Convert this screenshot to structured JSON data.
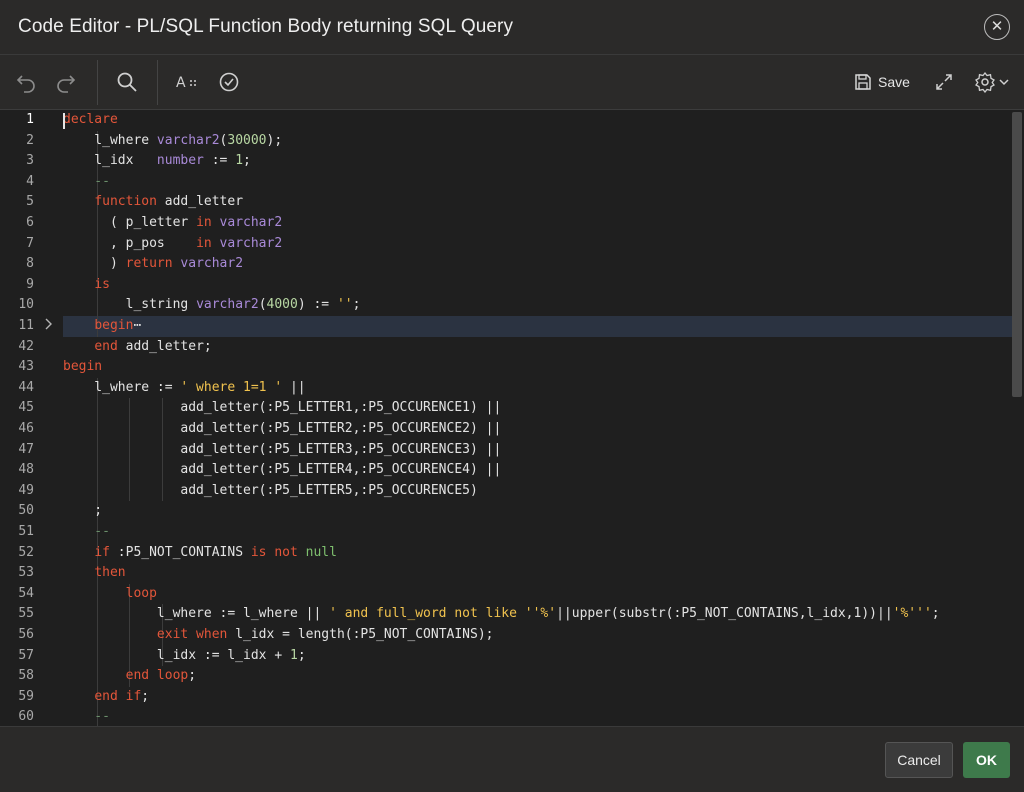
{
  "dialog": {
    "title": "Code Editor - PL/SQL Function Body returning SQL Query",
    "close_glyph": "✕"
  },
  "toolbar": {
    "undo_icon": "undo-icon",
    "redo_icon": "redo-icon",
    "search_icon": "search-icon",
    "autocomplete_icon": "autocomplete-icon",
    "validate_icon": "validate-icon",
    "save_label": "Save",
    "fullscreen_icon": "expand-icon",
    "settings_icon": "gear-icon"
  },
  "editor": {
    "lines": [
      {
        "num": "1",
        "tokens": [
          {
            "t": "declare",
            "c": "k"
          }
        ]
      },
      {
        "num": "2",
        "tokens": [
          {
            "t": "    l_where ",
            "c": "f"
          },
          {
            "t": "varchar2",
            "c": "t"
          },
          {
            "t": "(",
            "c": "f"
          },
          {
            "t": "30000",
            "c": "n"
          },
          {
            "t": ");",
            "c": "f"
          }
        ]
      },
      {
        "num": "3",
        "tokens": [
          {
            "t": "    l_idx   ",
            "c": "f"
          },
          {
            "t": "number",
            "c": "t"
          },
          {
            "t": " := ",
            "c": "f"
          },
          {
            "t": "1",
            "c": "n"
          },
          {
            "t": ";",
            "c": "f"
          }
        ]
      },
      {
        "num": "4",
        "tokens": [
          {
            "t": "    --",
            "c": "c"
          }
        ]
      },
      {
        "num": "5",
        "tokens": [
          {
            "t": "    ",
            "c": "f"
          },
          {
            "t": "function",
            "c": "k"
          },
          {
            "t": " add_letter",
            "c": "f"
          }
        ]
      },
      {
        "num": "6",
        "tokens": [
          {
            "t": "      ( p_letter ",
            "c": "f"
          },
          {
            "t": "in",
            "c": "k"
          },
          {
            "t": " ",
            "c": "f"
          },
          {
            "t": "varchar2",
            "c": "t"
          }
        ]
      },
      {
        "num": "7",
        "tokens": [
          {
            "t": "      , p_pos    ",
            "c": "f"
          },
          {
            "t": "in",
            "c": "k"
          },
          {
            "t": " ",
            "c": "f"
          },
          {
            "t": "varchar2",
            "c": "t"
          }
        ]
      },
      {
        "num": "8",
        "tokens": [
          {
            "t": "      ) ",
            "c": "f"
          },
          {
            "t": "return",
            "c": "k"
          },
          {
            "t": " ",
            "c": "f"
          },
          {
            "t": "varchar2",
            "c": "t"
          }
        ]
      },
      {
        "num": "9",
        "tokens": [
          {
            "t": "    ",
            "c": "f"
          },
          {
            "t": "is",
            "c": "k"
          }
        ]
      },
      {
        "num": "10",
        "tokens": [
          {
            "t": "        l_string ",
            "c": "f"
          },
          {
            "t": "varchar2",
            "c": "t"
          },
          {
            "t": "(",
            "c": "f"
          },
          {
            "t": "4000",
            "c": "n"
          },
          {
            "t": ") := ",
            "c": "f"
          },
          {
            "t": "''",
            "c": "s"
          },
          {
            "t": ";",
            "c": "f"
          }
        ]
      },
      {
        "num": "11",
        "tokens": [
          {
            "t": "    ",
            "c": "f"
          },
          {
            "t": "begin",
            "c": "k"
          },
          {
            "t": "⋯",
            "c": "f"
          }
        ]
      },
      {
        "num": "42",
        "tokens": [
          {
            "t": "    ",
            "c": "f"
          },
          {
            "t": "end",
            "c": "k"
          },
          {
            "t": " add_letter;",
            "c": "f"
          }
        ]
      },
      {
        "num": "43",
        "tokens": [
          {
            "t": "begin",
            "c": "k"
          }
        ]
      },
      {
        "num": "44",
        "tokens": [
          {
            "t": "    l_where := ",
            "c": "f"
          },
          {
            "t": "' where 1=1 '",
            "c": "s"
          },
          {
            "t": " ||",
            "c": "f"
          }
        ]
      },
      {
        "num": "45",
        "tokens": [
          {
            "t": "               add_letter(:P5_LETTER1,:P5_OCCURENCE1) ||",
            "c": "f"
          }
        ]
      },
      {
        "num": "46",
        "tokens": [
          {
            "t": "               add_letter(:P5_LETTER2,:P5_OCCURENCE2) ||",
            "c": "f"
          }
        ]
      },
      {
        "num": "47",
        "tokens": [
          {
            "t": "               add_letter(:P5_LETTER3,:P5_OCCURENCE3) ||",
            "c": "f"
          }
        ]
      },
      {
        "num": "48",
        "tokens": [
          {
            "t": "               add_letter(:P5_LETTER4,:P5_OCCURENCE4) ||",
            "c": "f"
          }
        ]
      },
      {
        "num": "49",
        "tokens": [
          {
            "t": "               add_letter(:P5_LETTER5,:P5_OCCURENCE5)",
            "c": "f"
          }
        ]
      },
      {
        "num": "50",
        "tokens": [
          {
            "t": "    ;",
            "c": "f"
          }
        ]
      },
      {
        "num": "51",
        "tokens": [
          {
            "t": "    --",
            "c": "c"
          }
        ]
      },
      {
        "num": "52",
        "tokens": [
          {
            "t": "    ",
            "c": "f"
          },
          {
            "t": "if",
            "c": "k"
          },
          {
            "t": " :P5_NOT_CONTAINS ",
            "c": "f"
          },
          {
            "t": "is not",
            "c": "k"
          },
          {
            "t": " ",
            "c": "f"
          },
          {
            "t": "null",
            "c": "g"
          }
        ]
      },
      {
        "num": "53",
        "tokens": [
          {
            "t": "    ",
            "c": "f"
          },
          {
            "t": "then",
            "c": "k"
          }
        ]
      },
      {
        "num": "54",
        "tokens": [
          {
            "t": "        ",
            "c": "f"
          },
          {
            "t": "loop",
            "c": "k"
          }
        ]
      },
      {
        "num": "55",
        "tokens": [
          {
            "t": "            l_where := l_where || ",
            "c": "f"
          },
          {
            "t": "' and full_word not like ''%'",
            "c": "s"
          },
          {
            "t": "||upper(substr(:P5_NOT_CONTAINS,l_idx,1))||",
            "c": "f"
          },
          {
            "t": "'%'''",
            "c": "s"
          },
          {
            "t": ";",
            "c": "f"
          }
        ]
      },
      {
        "num": "56",
        "tokens": [
          {
            "t": "            ",
            "c": "f"
          },
          {
            "t": "exit when",
            "c": "k"
          },
          {
            "t": " l_idx = length(:P5_NOT_CONTAINS);",
            "c": "f"
          }
        ]
      },
      {
        "num": "57",
        "tokens": [
          {
            "t": "            l_idx := l_idx + ",
            "c": "f"
          },
          {
            "t": "1",
            "c": "n"
          },
          {
            "t": ";",
            "c": "f"
          }
        ]
      },
      {
        "num": "58",
        "tokens": [
          {
            "t": "        ",
            "c": "f"
          },
          {
            "t": "end loop",
            "c": "k"
          },
          {
            "t": ";",
            "c": "f"
          }
        ]
      },
      {
        "num": "59",
        "tokens": [
          {
            "t": "    ",
            "c": "f"
          },
          {
            "t": "end if",
            "c": "k"
          },
          {
            "t": ";",
            "c": "f"
          }
        ]
      },
      {
        "num": "60",
        "tokens": [
          {
            "t": "    --",
            "c": "c"
          }
        ]
      }
    ]
  },
  "footer": {
    "cancel_label": "Cancel",
    "ok_label": "OK"
  }
}
